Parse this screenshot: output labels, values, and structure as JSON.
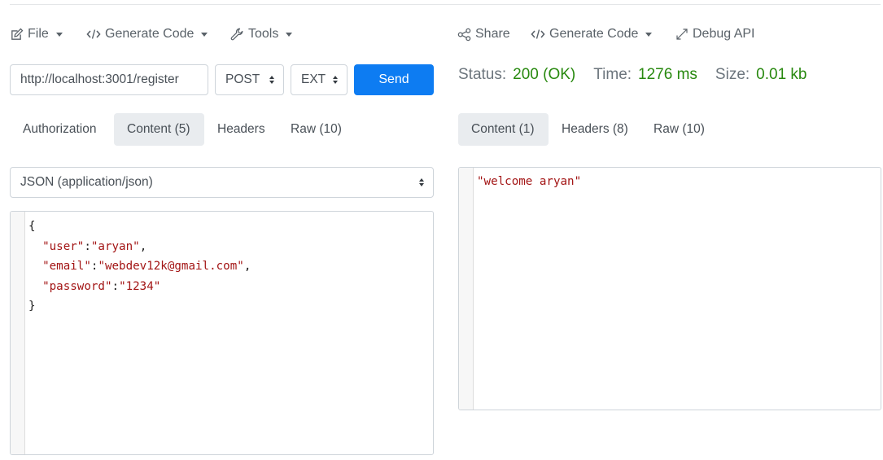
{
  "left_toolbar": {
    "file": "File",
    "generate_code": "Generate Code",
    "tools": "Tools"
  },
  "right_toolbar": {
    "share": "Share",
    "generate_code": "Generate Code",
    "debug_api": "Debug API"
  },
  "request": {
    "url": "http://localhost:3001/register",
    "method": "POST",
    "mode": "EXT",
    "send_label": "Send"
  },
  "request_tabs": [
    {
      "label": "Authorization",
      "active": false
    },
    {
      "label": "Content (5)",
      "active": true
    },
    {
      "label": "Headers",
      "active": false
    },
    {
      "label": "Raw (10)",
      "active": false
    }
  ],
  "content_type": "JSON (application/json)",
  "request_body": {
    "open": "{",
    "fields": [
      {
        "key": "\"user\"",
        "sep": ":",
        "value": "\"aryan\"",
        "trail": ","
      },
      {
        "key": "\"email\"",
        "sep": ":",
        "value": "\"webdev12k@gmail.com\"",
        "trail": ","
      },
      {
        "key": "\"password\"",
        "sep": ":",
        "value": "\"1234\"",
        "trail": ""
      }
    ],
    "close": "}"
  },
  "response": {
    "status_label": "Status:",
    "status_value": "200 (OK)",
    "time_label": "Time:",
    "time_value": "1276 ms",
    "size_label": "Size:",
    "size_value": "0.01 kb",
    "status_color": "#28890f",
    "body": "\"welcome aryan\""
  },
  "response_tabs": [
    {
      "label": "Content (1)",
      "active": true
    },
    {
      "label": "Headers (8)",
      "active": false
    },
    {
      "label": "Raw (10)",
      "active": false
    }
  ],
  "colors": {
    "accent": "#0d7cf2",
    "string": "#a31515",
    "tab_active_bg": "#e9ecef"
  }
}
